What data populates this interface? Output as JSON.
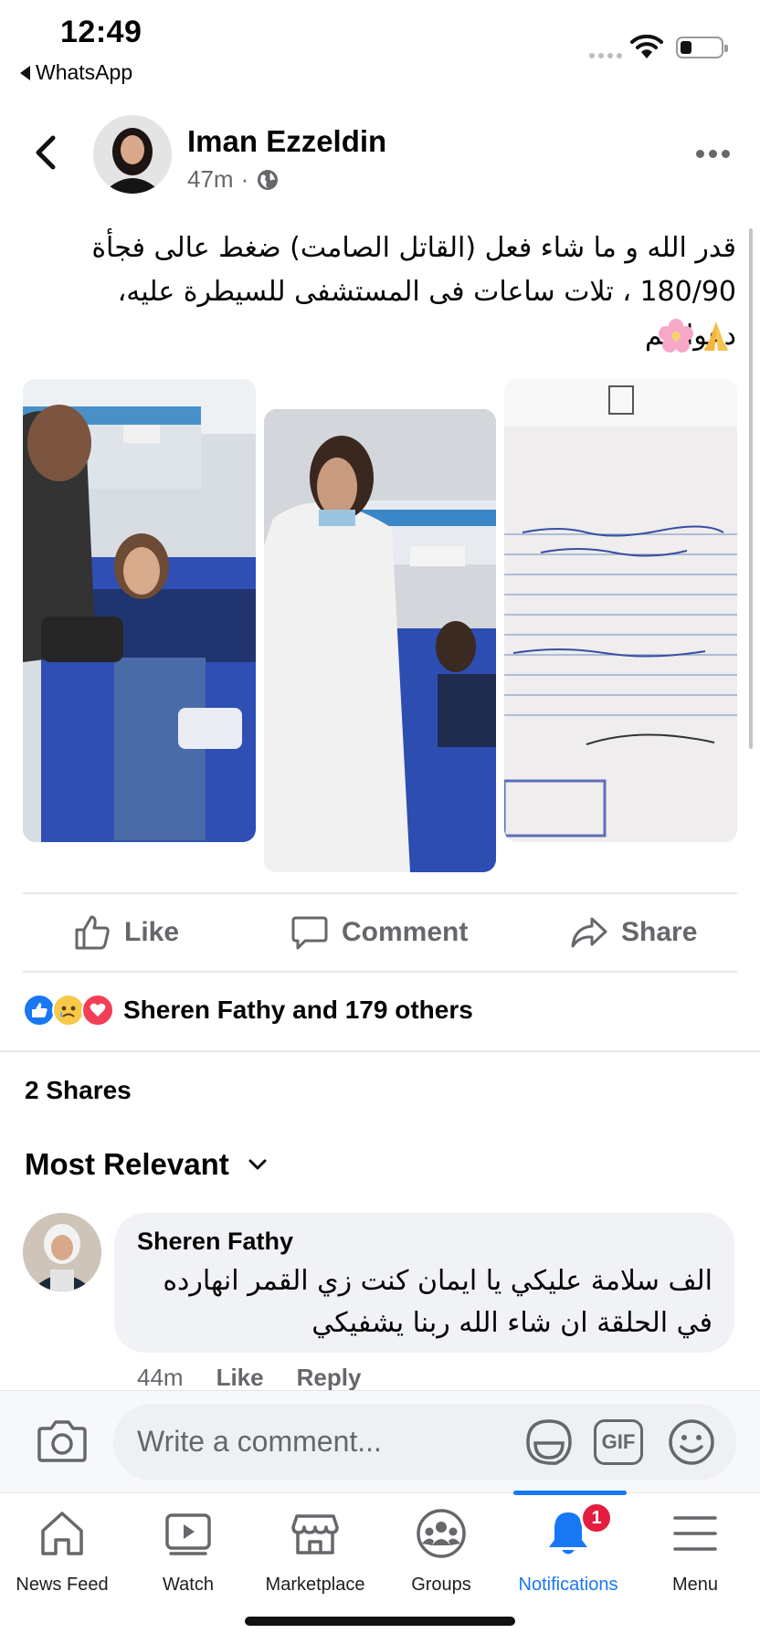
{
  "status_bar": {
    "time": "12:49",
    "back_app": "WhatsApp"
  },
  "post": {
    "author": "Iman Ezzeldin",
    "time_ago": "47m",
    "separator": "·",
    "text": "قدر الله و ما شاء فعل (القاتل الصامت) ضغط عالى فجأة 180/90 ، تلات ساعات فى المستشفى للسيطرة عليه، دعواتكم",
    "emojis": [
      "pray-icon",
      "cherry-blossom-icon"
    ],
    "photos": [
      "patient-bed-photo",
      "doctor-photo",
      "medical-report-photo"
    ]
  },
  "actions": {
    "like": "Like",
    "comment": "Comment",
    "share": "Share"
  },
  "reactions": {
    "icons": [
      "like-reaction-icon",
      "sad-reaction-icon",
      "love-reaction-icon"
    ],
    "text": "Sheren Fathy and 179 others"
  },
  "shares_text": "2 Shares",
  "sort_label": "Most Relevant",
  "comment": {
    "author": "Sheren Fathy",
    "text": "الف سلامة عليكي يا ايمان كنت زي القمر انهارده في الحلقة ان شاء الله ربنا يشفيكي",
    "time_ago": "44m",
    "like": "Like",
    "reply": "Reply"
  },
  "composer": {
    "placeholder": "Write a comment...",
    "gif": "GIF"
  },
  "tabs": [
    {
      "label": "News Feed",
      "icon": "home-icon"
    },
    {
      "label": "Watch",
      "icon": "watch-icon"
    },
    {
      "label": "Marketplace",
      "icon": "marketplace-icon"
    },
    {
      "label": "Groups",
      "icon": "groups-icon"
    },
    {
      "label": "Notifications",
      "icon": "bell-icon",
      "badge": "1",
      "active": true
    },
    {
      "label": "Menu",
      "icon": "menu-icon"
    }
  ],
  "colors": {
    "accent": "#1877f2",
    "badge": "#e41e3f",
    "secondary_text": "#65676b"
  }
}
